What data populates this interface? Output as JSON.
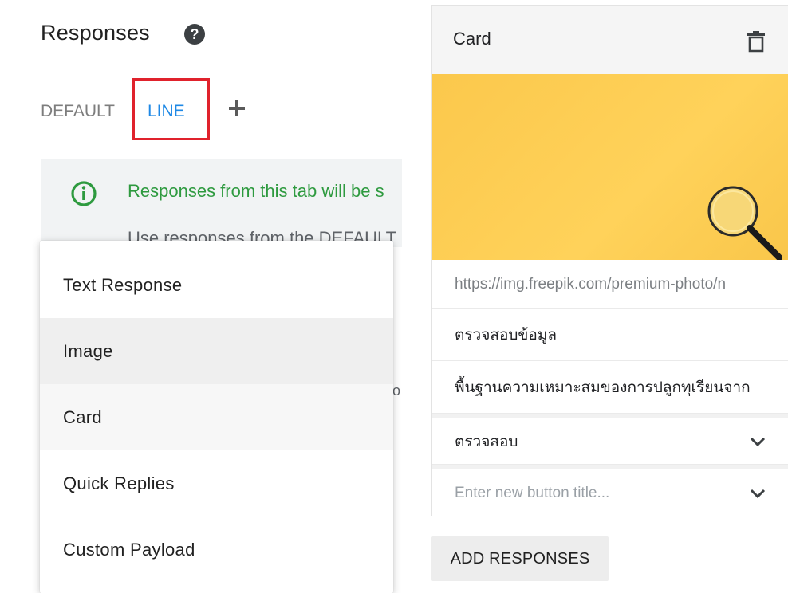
{
  "header": {
    "title": "Responses"
  },
  "tabs": [
    {
      "label": "DEFAULT"
    },
    {
      "label": "LINE"
    }
  ],
  "info": {
    "line1": "Responses from this tab will be s",
    "line2": "Use responses from the DEFAULT"
  },
  "stray_char": "o",
  "menu": {
    "items": [
      {
        "label": "Text Response"
      },
      {
        "label": "Image"
      },
      {
        "label": "Card"
      },
      {
        "label": "Quick Replies"
      },
      {
        "label": "Custom Payload"
      }
    ]
  },
  "card": {
    "header_title": "Card",
    "image_url": "https://img.freepik.com/premium-photo/n",
    "title_value": "ตรวจสอบข้อมูล",
    "subtitle_value": "พื้นฐานความเหมาะสมของการปลูกทุเรียนจาก",
    "button1_title": "ตรวจสอบ",
    "button_placeholder": "Enter new button title..."
  },
  "actions": {
    "add_responses": "ADD RESPONSES"
  },
  "colors": {
    "active_tab": "#1e88e5",
    "highlight_border": "#e0222c",
    "info_text": "#2e9a3f",
    "image_bg": "#fbc84c"
  }
}
